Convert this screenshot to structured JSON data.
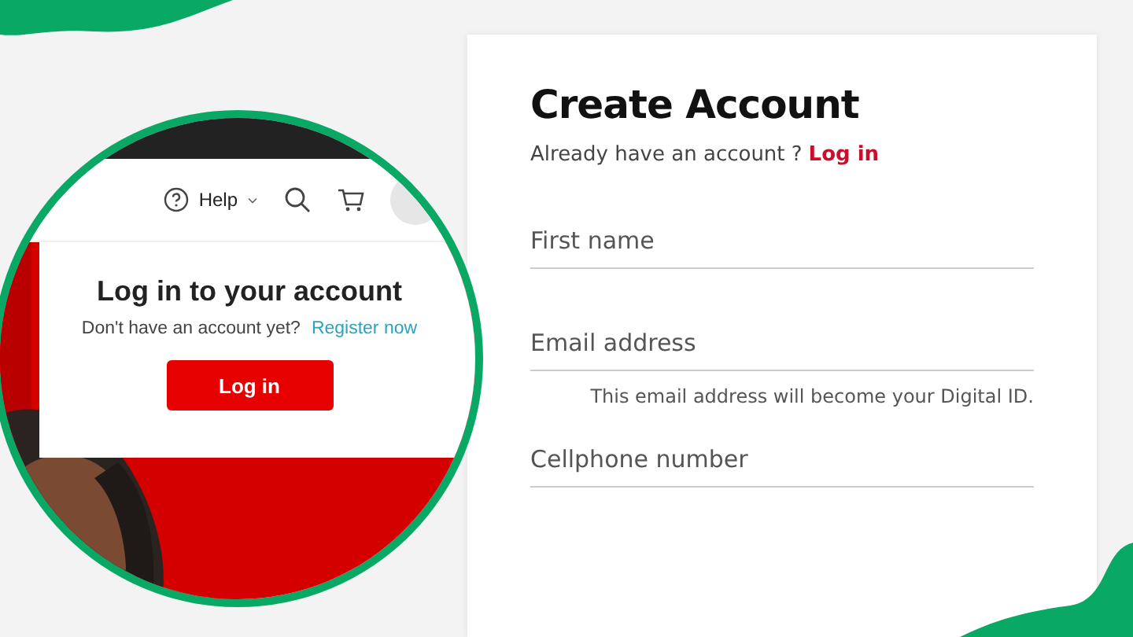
{
  "login_popup": {
    "help": "Help",
    "title": "Log in to your account",
    "prompt": "Don't have an account yet?",
    "register_link": "Register now",
    "login_button": "Log in"
  },
  "create_account": {
    "title": "Create Account",
    "prompt": "Already have an account ?",
    "login_link": "Log in",
    "fields": [
      {
        "placeholder": "First name"
      },
      {
        "placeholder": "Email address",
        "hint": "This email address will become your Digital ID."
      },
      {
        "placeholder": "Cellphone number"
      }
    ]
  }
}
